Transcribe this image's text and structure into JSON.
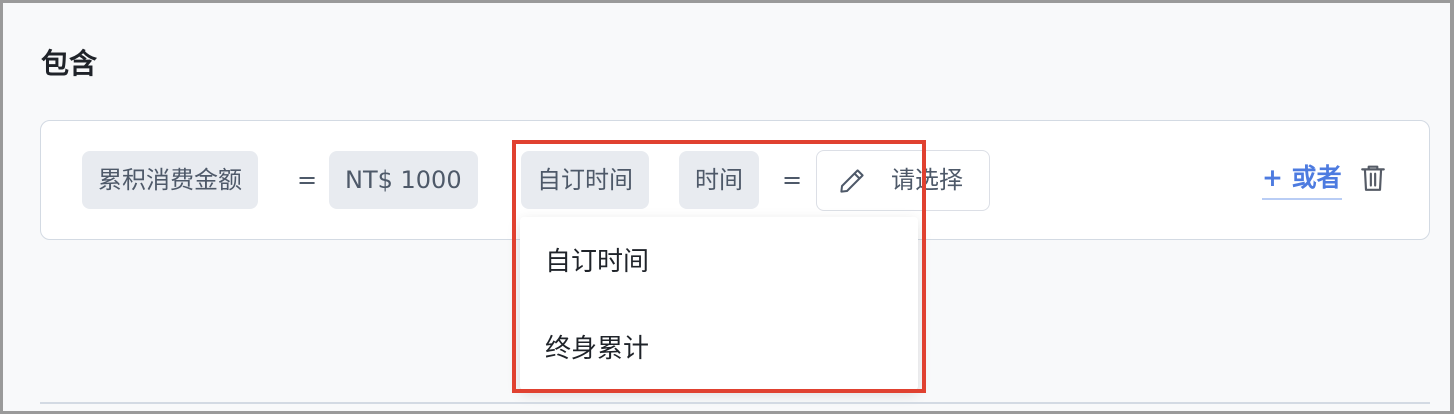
{
  "section": {
    "title": "包含"
  },
  "condition": {
    "metric": "累积消费金额",
    "operator1": "=",
    "amount": "NT$ 1000",
    "time_mode": "自订时间",
    "time_field": "时间",
    "operator2": "=",
    "select_placeholder": "请选择",
    "or_label": "+ 或者"
  },
  "dropdown": {
    "options": [
      "自订时间",
      "终身累计"
    ]
  },
  "colors": {
    "accent": "#4d7be0",
    "highlight": "#e04130",
    "chip_bg": "#e8ebf0"
  },
  "icons": {
    "edit": "pencil-icon",
    "delete": "trash-icon"
  }
}
